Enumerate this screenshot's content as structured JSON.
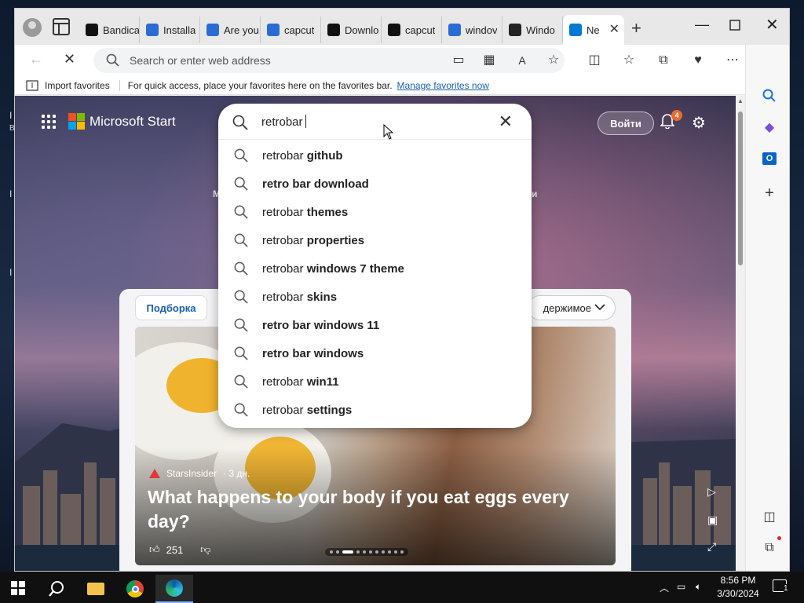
{
  "desktop": {
    "labels": [
      "I",
      "B",
      "I",
      "I",
      "I"
    ]
  },
  "browser": {
    "tabs": [
      {
        "title": "Bandica",
        "favicon": "bandicam-icon",
        "color": "#111111"
      },
      {
        "title": "Installa",
        "favicon": "page-icon",
        "color": "#2b6cd4"
      },
      {
        "title": "Are you",
        "favicon": "page-icon",
        "color": "#2b6cd4"
      },
      {
        "title": "capcut",
        "favicon": "search-icon",
        "color": "#2b6cd4"
      },
      {
        "title": "Downlo",
        "favicon": "capcut-icon",
        "color": "#111111"
      },
      {
        "title": "capcut",
        "favicon": "capcut-icon",
        "color": "#111111"
      },
      {
        "title": "windov",
        "favicon": "search-icon",
        "color": "#2b6cd4"
      },
      {
        "title": "Windo",
        "favicon": "wh-icon",
        "color": "#222222"
      },
      {
        "title": "Ne",
        "favicon": "loading-icon",
        "color": "#0078d4",
        "active": true
      }
    ],
    "address_placeholder": "Search or enter web address",
    "favorites_bar": {
      "import_label": "Import favorites",
      "message": "For quick access, place your favorites here on the favorites bar.",
      "link": "Manage favorites now"
    }
  },
  "page": {
    "brand": "Microsoft Start",
    "signin_label": "Войти",
    "notification_count": "4",
    "hint_left": "М",
    "hint_right": "и",
    "feed_tab": "Подборка",
    "content_dropdown": "держимое",
    "article": {
      "source": "StarsInsider",
      "age": "· 3 дн.",
      "headline": "What happens to your body if you eat eggs every day?",
      "likes": "251"
    }
  },
  "search": {
    "query": "retrobar",
    "suggestions": [
      {
        "prefix": "retrobar ",
        "bold": "github"
      },
      {
        "prefix": "",
        "bold": "retro bar download"
      },
      {
        "prefix": "retrobar ",
        "bold": "themes"
      },
      {
        "prefix": "retrobar ",
        "bold": "properties"
      },
      {
        "prefix": "retrobar ",
        "bold": "windows 7 theme"
      },
      {
        "prefix": "retrobar ",
        "bold": "skins"
      },
      {
        "prefix": "",
        "bold": "retro bar windows 11"
      },
      {
        "prefix": "",
        "bold": "retro bar windows"
      },
      {
        "prefix": "retrobar ",
        "bold": "win11"
      },
      {
        "prefix": "retrobar ",
        "bold": "settings"
      }
    ]
  },
  "taskbar": {
    "time": "8:56 PM",
    "date": "3/30/2024",
    "notification_count": "1"
  },
  "colors": {
    "accent": "#0078d4",
    "link": "#1a5fb4",
    "badge": "#e66b2e"
  }
}
